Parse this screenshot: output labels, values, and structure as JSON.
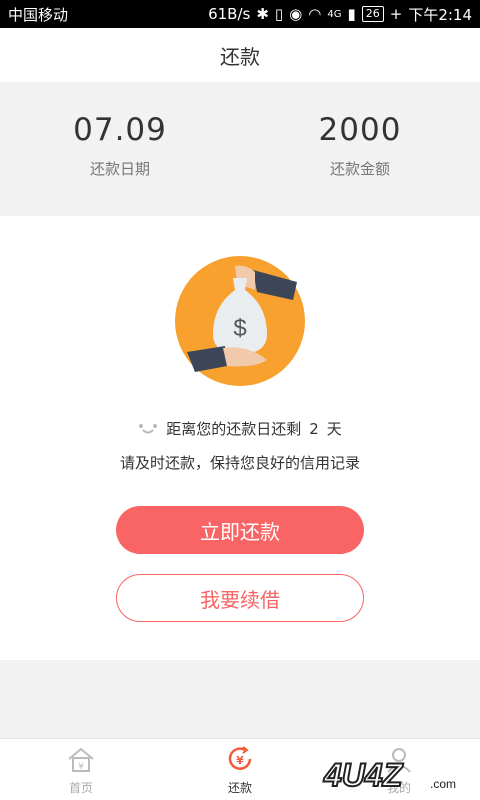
{
  "status": {
    "carrier": "中国移动",
    "speed": "61B/s",
    "network": "4G",
    "battery": "26",
    "time": "下午2:14"
  },
  "nav": {
    "title": "还款"
  },
  "summary": {
    "date_value": "07.09",
    "date_label": "还款日期",
    "amount_value": "2000",
    "amount_label": "还款金额"
  },
  "illustration": {
    "symbol": "$",
    "bag_color": "#e9edf0",
    "circle_color": "#f9a12e"
  },
  "info": {
    "countdown_prefix": "距离您的还款日还剩",
    "days": "2",
    "days_unit": "天",
    "advice": "请及时还款，保持您良好的信用记录"
  },
  "actions": {
    "repay_now": "立即还款",
    "renew": "我要续借"
  },
  "tabs": [
    {
      "label": "首页",
      "icon": "home-icon"
    },
    {
      "label": "还款",
      "icon": "repay-yen-icon",
      "active": true
    },
    {
      "label": "我的",
      "icon": "profile-icon"
    }
  ],
  "watermark": {
    "text": "4U4Z.com"
  },
  "colors": {
    "accent": "#f96464",
    "orange": "#f9a12e",
    "tab_active": "#f25a3c"
  }
}
